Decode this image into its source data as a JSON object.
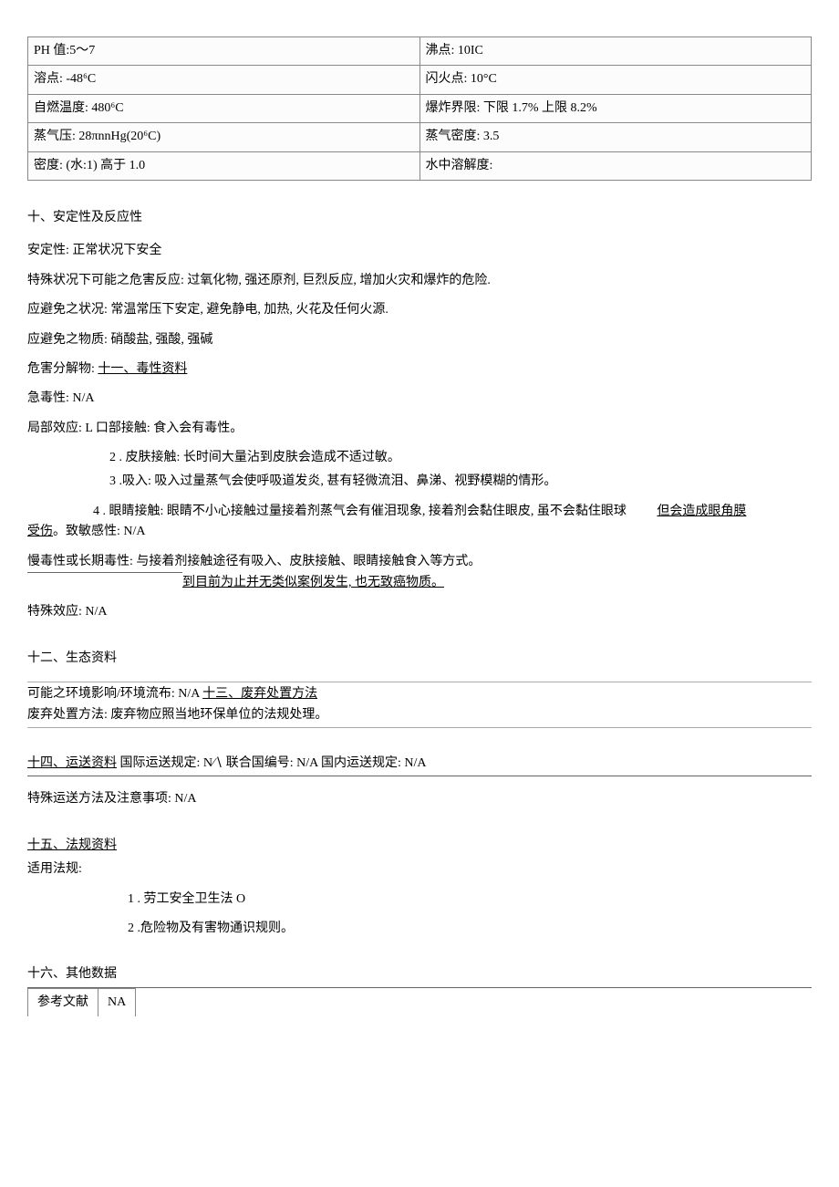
{
  "props": {
    "ph": "PH 值:5～7",
    "boil": "沸点:   10IC",
    "melt": "溶点: -48⁶C",
    "flash": "闪火点:  10°C",
    "autoign": "自燃温度:  480⁶C",
    "explosion": "爆炸界限:  下限 1.7% 上限 8.2%",
    "vapor_p": "蒸气压:  28πnnHg(20⁶C)",
    "vapor_d": "蒸气密度:  3.5",
    "density": "密度:   (水:1)  高于 1.0",
    "solubility": "水中溶解度:"
  },
  "s10": {
    "title": "十、安定性及反应性",
    "stability": "安定性:  正常状况下安全",
    "special": "特殊状况下可能之危害反应:  过氧化物, 强还原剂,  巨烈反应, 增加火灾和爆炸的危险.",
    "avoid_cond": "应避免之状况:  常温常压下安定, 避免静电, 加热,   火花及任何火源.",
    "avoid_mat": "应避免之物质:  硝酸盐, 强酸, 强碱",
    "decomp_a": "危害分解物:  ",
    "decomp_b": "十一、毒性资料",
    "acute": "急毒性:  N/A",
    "local_a": "局部效应:  L 口部接触:  食入会有毒性。",
    "local_2": "2   . 皮肤接触:  长时间大量沾到皮肤会造成不适过敏。",
    "local_3": "3    .吸入:  吸入过量蒸气会使呼吸道发炎,  甚有轻微流泪、鼻涕、视野模糊的情形。",
    "local_4": "4    . 眼睛接触:  眼睛不小心接触过量接着剂蒸气会有催泪现象,  接着剂会黏住眼皮,  虽不会黏住眼球",
    "local_4_trail": "但会造成眼角膜",
    "injury_a": "受伤",
    "injury_b": "。致敏感性:  N/A",
    "chronic": "慢毒性或长期毒性:  与接着剂接触途径有吸入、皮肤接触、眼睛接触食入等方式。",
    "chronic2": "到目前为止并无类似案例发生,  也无致癌物质。",
    "special_eff": "特殊效应:  N/A"
  },
  "s12": {
    "title": "十二、生态资料",
    "env_a": "可能之环境影响/环境流布:  N/A ",
    "env_b": "十三、废弃处置方法",
    "disposal": "废弃处置方法:  废弃物应照当地环保单位的法规处理。"
  },
  "s14": {
    "title_a": "十四、运送资料",
    "title_b": " 国际运送规定:  N∕∖ 联合国编号:  N/A 国内运送规定:  N/A",
    "special_ship": "特殊运送方法及注意事项:  N/A"
  },
  "s15": {
    "title": "十五、法规资料",
    "apply": "适用法规:",
    "law1": "1  . 劳工安全卫生法 O",
    "law2": "2   .危险物及有害物通识规则。"
  },
  "s16": {
    "title": "十六、其他数据",
    "ref_label": "参考文献",
    "ref_val": "NA"
  }
}
